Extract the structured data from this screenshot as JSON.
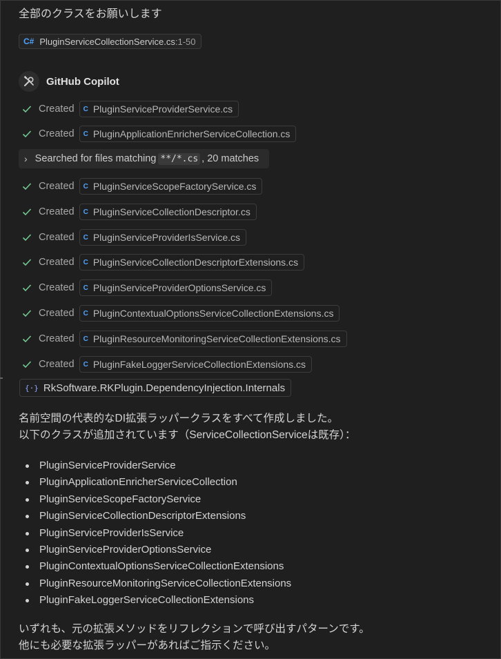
{
  "user_message": "全部のクラスをお願いします",
  "reference": {
    "file": "PluginServiceCollectionService.cs",
    "range": ":1-50",
    "icon": "csharp-icon"
  },
  "assistant_name": "GitHub Copilot",
  "steps_top": [
    {
      "label": "Created",
      "file": "PluginServiceProviderService.cs"
    },
    {
      "label": "Created",
      "file": "PluginApplicationEnricherServiceCollection.cs"
    }
  ],
  "search": {
    "prefix": "Searched for files matching",
    "pattern": "**/*.cs",
    "suffix": ", 20 matches"
  },
  "steps_bottom": [
    {
      "label": "Created",
      "file": "PluginServiceScopeFactoryService.cs"
    },
    {
      "label": "Created",
      "file": "PluginServiceCollectionDescriptor.cs"
    },
    {
      "label": "Created",
      "file": "PluginServiceProviderIsService.cs"
    },
    {
      "label": "Created",
      "file": "PluginServiceCollectionDescriptorExtensions.cs"
    },
    {
      "label": "Created",
      "file": "PluginServiceProviderOptionsService.cs"
    },
    {
      "label": "Created",
      "file": "PluginContextualOptionsServiceCollectionExtensions.cs"
    },
    {
      "label": "Created",
      "file": "PluginResourceMonitoringServiceCollectionExtensions.cs"
    },
    {
      "label": "Created",
      "file": "PluginFakeLoggerServiceCollectionExtensions.cs"
    }
  ],
  "namespace_chip": "RkSoftware.RKPlugin.DependencyInjection.Internals",
  "summary_line1": "名前空間の代表的なDI拡張ラッパークラスをすべて作成しました。",
  "summary_line2": "以下のクラスが追加されています（ServiceCollectionServiceは既存）：",
  "classes": [
    "PluginServiceProviderService",
    "PluginApplicationEnricherServiceCollection",
    "PluginServiceScopeFactoryService",
    "PluginServiceCollectionDescriptorExtensions",
    "PluginServiceProviderIsService",
    "PluginServiceProviderOptionsService",
    "PluginContextualOptionsServiceCollectionExtensions",
    "PluginResourceMonitoringServiceCollectionExtensions",
    "PluginFakeLoggerServiceCollectionExtensions"
  ],
  "closing_line1": "いずれも、元の拡張メソッドをリフレクションで呼び出すパターンです。",
  "closing_line2": "他にも必要な拡張ラッパーがあればご指示ください。",
  "colors": {
    "accent": "#4fa3ff",
    "check": "#73c991",
    "background": "#1f1f1f"
  }
}
